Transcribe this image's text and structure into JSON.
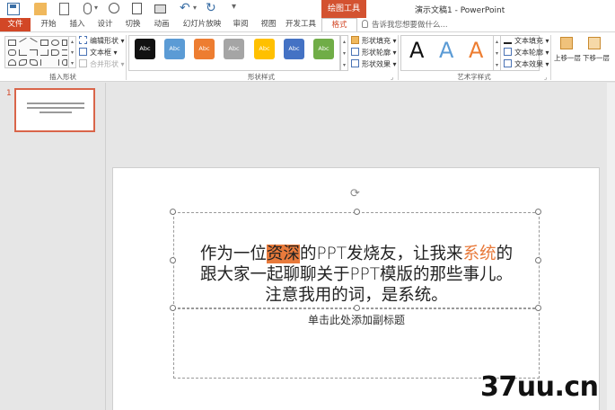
{
  "quick_access": {
    "icons": [
      "save-icon",
      "open-icon",
      "new-icon",
      "mouse-icon",
      "touch-mode-icon",
      "print-preview-icon",
      "quick-print-icon",
      "undo-icon",
      "redo-icon",
      "customize-icon"
    ],
    "undo_glyph": "↶",
    "redo_glyph": "↻",
    "more_glyph": "▾"
  },
  "context_tab": {
    "label": "绘图工具"
  },
  "window": {
    "title": "演示文稿1 - PowerPoint"
  },
  "tabs": [
    {
      "label": "文件"
    },
    {
      "label": "开始"
    },
    {
      "label": "插入"
    },
    {
      "label": "设计"
    },
    {
      "label": "切换"
    },
    {
      "label": "动画"
    },
    {
      "label": "幻灯片放映"
    },
    {
      "label": "审阅"
    },
    {
      "label": "视图"
    },
    {
      "label": "开发工具"
    },
    {
      "label": "格式"
    }
  ],
  "tell_me": {
    "placeholder": "告诉我您想要做什么..."
  },
  "ribbon": {
    "insert_shapes": {
      "label": "插入形状",
      "edit_shape": "编辑形状",
      "text_box": "文本框",
      "merge_shapes": "合并形状"
    },
    "shape_styles": {
      "label": "形状样式",
      "swatch_text": "Abc",
      "swatches": [
        "#111111",
        "#5b9bd5",
        "#ed7d31",
        "#a5a5a5",
        "#ffc000",
        "#4472c4",
        "#70ad47"
      ],
      "fill": "形状填充",
      "outline": "形状轮廓",
      "effects": "形状效果"
    },
    "wordart_styles": {
      "label": "艺术字样式",
      "samples": [
        {
          "letter": "A",
          "color": "#111111"
        },
        {
          "letter": "A",
          "color": "#5b9bd5"
        },
        {
          "letter": "A",
          "color": "#ed7d31"
        }
      ],
      "text_fill": "文本填充",
      "text_outline": "文本轮廓",
      "text_effects": "文本效果"
    },
    "arrange": {
      "bring_forward": "上移一层",
      "send_backward": "下移一层"
    }
  },
  "thumbnails": [
    {
      "number": "1"
    }
  ],
  "slide": {
    "title": {
      "line1_a": "作为一位",
      "line1_hl": "资深",
      "line1_b": "的PPT发烧友，让我来",
      "line1_orange": "系统",
      "line1_c": "的",
      "line2": "跟大家一起聊聊关于PPT模版的那些事儿。",
      "line3": "注意我用的词，是系统。"
    },
    "subtitle_placeholder": "单击此处添加副标题"
  },
  "watermark": "37uu.cn"
}
